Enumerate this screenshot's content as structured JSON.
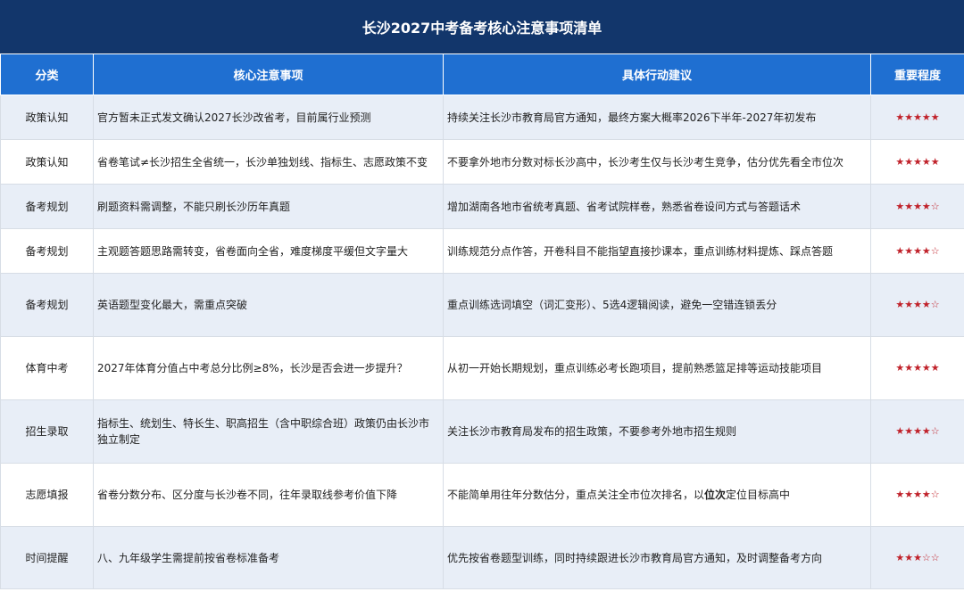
{
  "title": "长沙2027中考备考核心注意事项清单",
  "headers": [
    "分类",
    "核心注意事项",
    "具体行动建议",
    "重要程度"
  ],
  "rows": [
    {
      "category": "政策认知",
      "issue": "官方暂未正式发文确认2027长沙改省考，目前属行业预测",
      "advice": "持续关注长沙市教育局官方通知，最终方案大概率2026下半年-2027年初发布",
      "importance": "★★★★★"
    },
    {
      "category": "政策认知",
      "issue": "省卷笔试≠长沙招生全省统一，长沙单独划线、指标生、志愿政策不变",
      "advice": "不要拿外地市分数对标长沙高中，长沙考生仅与长沙考生竞争，估分优先看全市位次",
      "importance": "★★★★★"
    },
    {
      "category": "备考规划",
      "issue": "刷题资料需调整，不能只刷长沙历年真题",
      "advice": "增加湖南各地市省统考真题、省考试院样卷，熟悉省卷设问方式与答题话术",
      "importance": "★★★★☆"
    },
    {
      "category": "备考规划",
      "issue": "主观题答题思路需转变，省卷面向全省，难度梯度平缓但文字量大",
      "advice": "训练规范分点作答，开卷科目不能指望直接抄课本，重点训练材料提炼、踩点答题",
      "importance": "★★★★☆"
    },
    {
      "category": "备考规划",
      "issue": "英语题型变化最大，需重点突破",
      "advice": "重点训练选词填空（词汇变形）、5选4逻辑阅读，避免一空错连锁丢分",
      "importance": "★★★★☆"
    },
    {
      "category": "体育中考",
      "issue": "2027年体育分值占中考总分比例≥8%，长沙是否会进一步提升？",
      "advice": "从初一开始长期规划，重点训练必考长跑项目，提前熟悉篮足排等运动技能项目",
      "importance": "★★★★★"
    },
    {
      "category": "招生录取",
      "issue": "指标生、统划生、特长生、职高招生（含中职综合班）政策仍由长沙市独立制定",
      "advice": "关注长沙市教育局发布的招生政策，不要参考外地市招生规则",
      "importance": "★★★★☆"
    },
    {
      "category": "志愿填报",
      "issue": "省卷分数分布、区分度与长沙卷不同，往年录取线参考价值下降",
      "advice_before": "不能简单用往年分数估分，重点关注全市位次排名，以",
      "advice_bold": "位次",
      "advice_after": "定位目标高中",
      "importance": "★★★★☆"
    },
    {
      "category": "时间提醒",
      "issue": "八、九年级学生需提前按省卷标准备考",
      "advice": "优先按省卷题型训练，同时持续跟进长沙市教育局官方通知，及时调整备考方向",
      "importance": "★★★☆☆"
    }
  ]
}
